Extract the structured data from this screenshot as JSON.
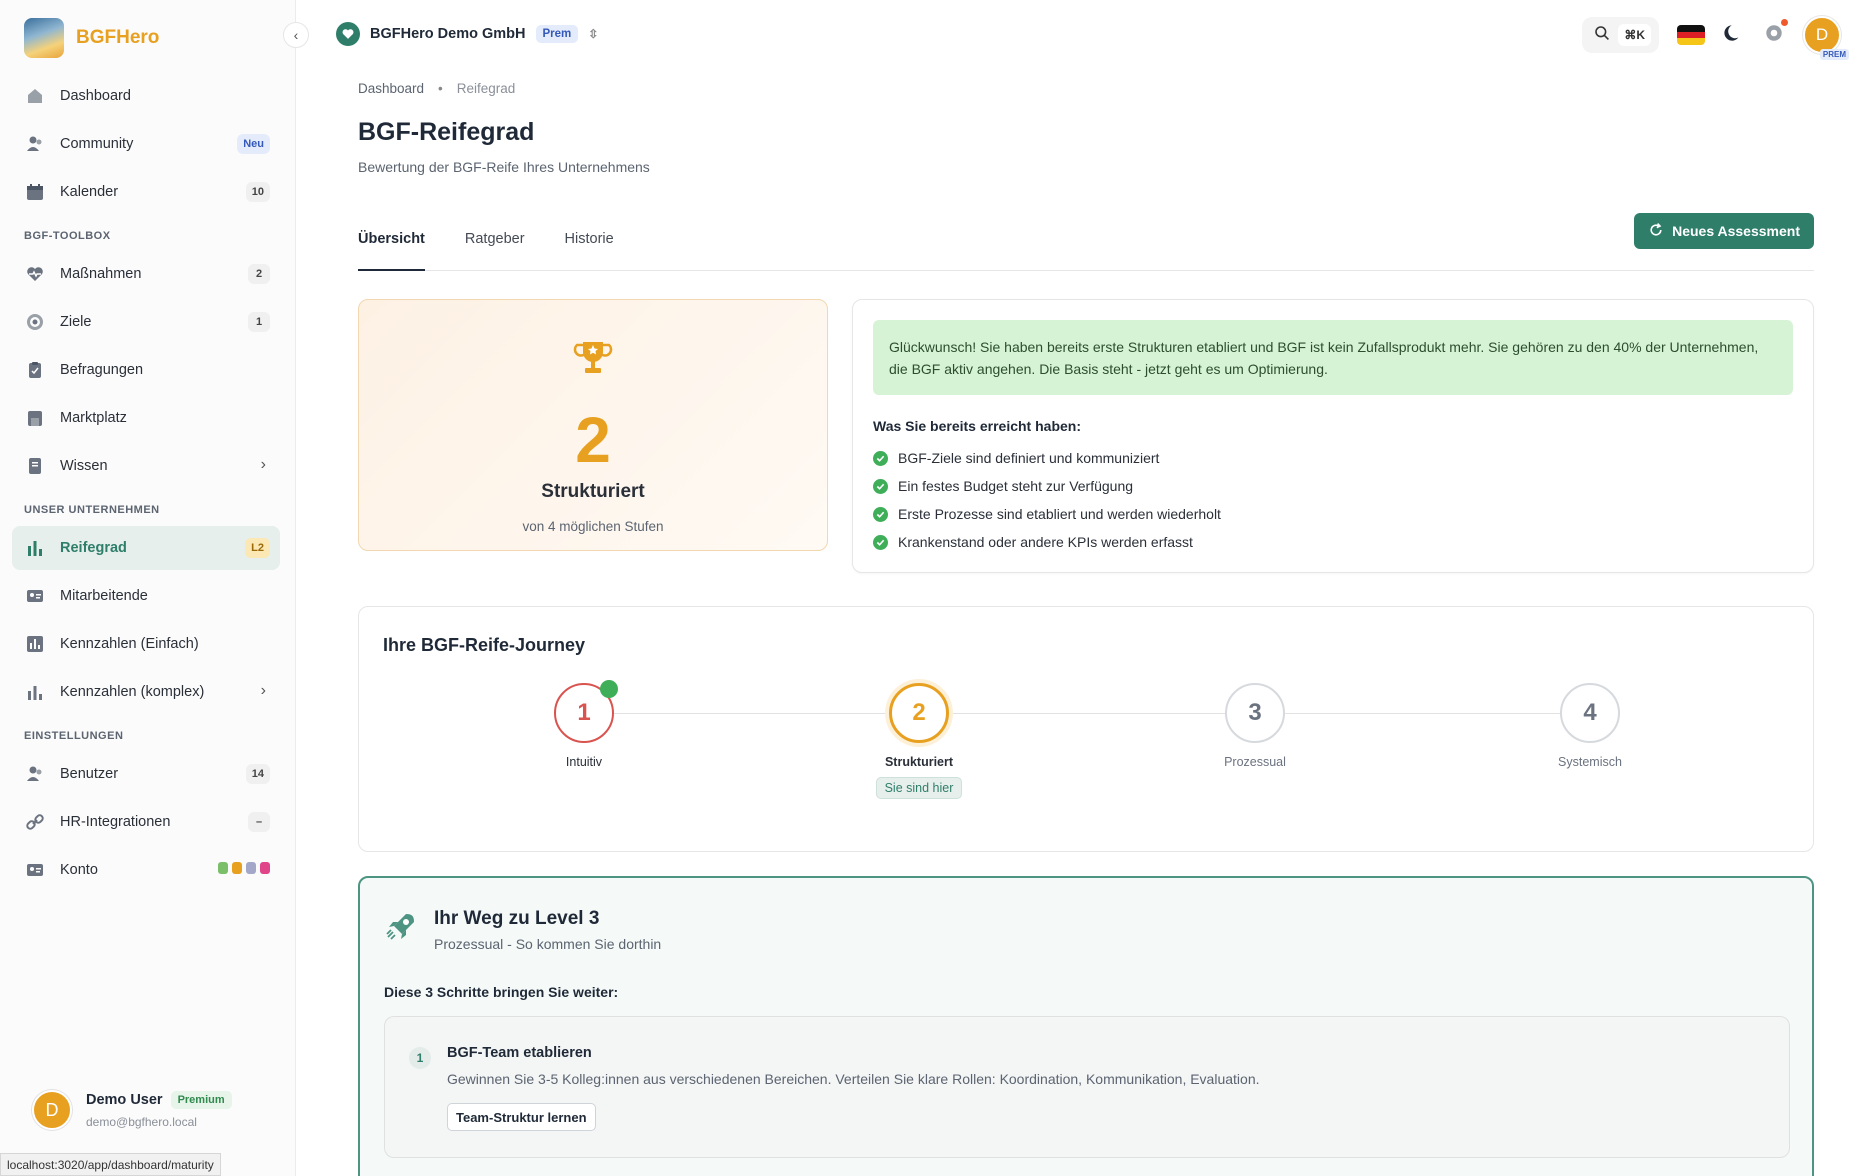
{
  "brand": {
    "name": "BGFHero"
  },
  "sidebar": {
    "items_top": [
      {
        "label": "Dashboard",
        "badge": ""
      },
      {
        "label": "Community",
        "badge": "Neu"
      },
      {
        "label": "Kalender",
        "badge": "10"
      }
    ],
    "section_toolbox": "BGF-TOOLBOX",
    "items_toolbox": [
      {
        "label": "Maßnahmen",
        "badge": "2"
      },
      {
        "label": "Ziele",
        "badge": "1"
      },
      {
        "label": "Befragungen",
        "badge": ""
      },
      {
        "label": "Marktplatz",
        "badge": ""
      },
      {
        "label": "Wissen",
        "badge": ""
      }
    ],
    "section_company": "UNSER UNTERNEHMEN",
    "items_company": [
      {
        "label": "Reifegrad",
        "badge": "L2"
      },
      {
        "label": "Mitarbeitende",
        "badge": ""
      },
      {
        "label": "Kennzahlen (Einfach)",
        "badge": ""
      },
      {
        "label": "Kennzahlen (komplex)",
        "badge": ""
      }
    ],
    "section_settings": "EINSTELLUNGEN",
    "items_settings": [
      {
        "label": "Benutzer",
        "badge": "14"
      },
      {
        "label": "HR-Integrationen",
        "badge": "–"
      },
      {
        "label": "Konto",
        "badge": ""
      }
    ]
  },
  "user": {
    "initial": "D",
    "name": "Demo User",
    "tier": "Premium",
    "email": "demo@bgfhero.local"
  },
  "status_url": "localhost:3020/app/dashboard/maturity",
  "topbar": {
    "org_name": "BGFHero Demo GmbH",
    "org_tier": "Prem",
    "shortcut": "⌘K",
    "avatar_initial": "D",
    "avatar_tag": "PREM"
  },
  "breadcrumb": {
    "home": "Dashboard",
    "current": "Reifegrad"
  },
  "page": {
    "title": "BGF-Reifegrad",
    "subtitle": "Bewertung der BGF-Reife Ihres Unternehmens"
  },
  "tabs": [
    "Übersicht",
    "Ratgeber",
    "Historie"
  ],
  "new_assessment_label": "Neues Assessment",
  "level": {
    "number": "2",
    "name": "Strukturiert",
    "of": "von 4 möglichen Stufen"
  },
  "congrats_text": "Glückwunsch! Sie haben bereits erste Strukturen etabliert und BGF ist kein Zufallsprodukt mehr. Sie gehören zu den 40% der Unternehmen, die BGF aktiv angehen. Die Basis steht - jetzt geht es um Optimierung.",
  "achieved": {
    "title": "Was Sie bereits erreicht haben:",
    "items": [
      "BGF-Ziele sind definiert und kommuniziert",
      "Ein festes Budget steht zur Verfügung",
      "Erste Prozesse sind etabliert und werden wiederholt",
      "Krankenstand oder andere KPIs werden erfasst"
    ]
  },
  "journey": {
    "title": "Ihre BGF-Reife-Journey",
    "here_label": "Sie sind hier",
    "steps": [
      {
        "num": "1",
        "label": "Intuitiv",
        "state": "done"
      },
      {
        "num": "2",
        "label": "Strukturiert",
        "state": "current"
      },
      {
        "num": "3",
        "label": "Prozessual",
        "state": "future"
      },
      {
        "num": "4",
        "label": "Systemisch",
        "state": "future"
      }
    ]
  },
  "next_level": {
    "title": "Ihr Weg zu Level 3",
    "subtitle": "Prozessual - So kommen Sie dorthin",
    "intro": "Diese 3 Schritte bringen Sie weiter:",
    "steps": [
      {
        "num": "1",
        "title": "BGF-Team etablieren",
        "desc": "Gewinnen Sie 3-5 Kolleg:innen aus verschiedenen Bereichen. Verteilen Sie klare Rollen: Koordination, Kommunikation, Evaluation.",
        "button": "Team-Struktur lernen"
      }
    ]
  },
  "colors": {
    "accent": "#2f7e6a",
    "brand": "#e8a020",
    "success": "#3fae59",
    "step1": "#d9534f"
  }
}
